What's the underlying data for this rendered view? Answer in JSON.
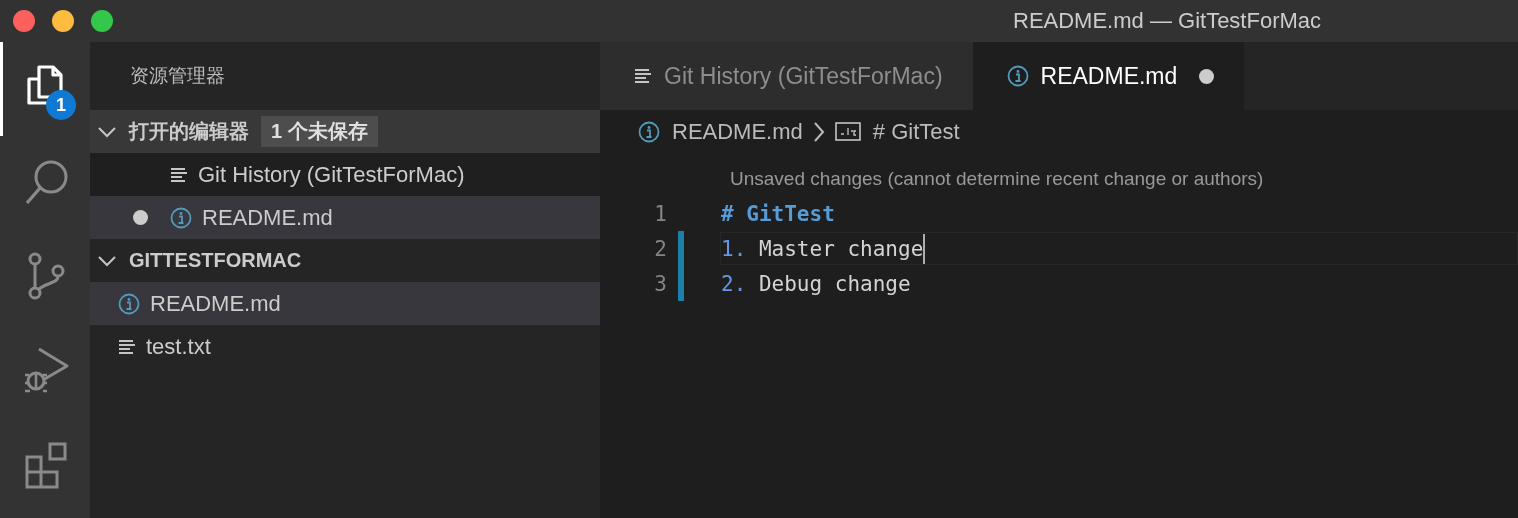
{
  "window": {
    "title": "README.md — GitTestForMac"
  },
  "activity_bar": [
    {
      "kind": "explorer",
      "selected": true,
      "badge": "1"
    },
    {
      "kind": "search",
      "selected": false
    },
    {
      "kind": "source-control",
      "selected": false
    },
    {
      "kind": "debug",
      "selected": false
    },
    {
      "kind": "extensions",
      "selected": false
    }
  ],
  "sidebar": {
    "title": "资源管理器",
    "sections": [
      {
        "label": "打开的编辑器",
        "kind": "plain",
        "badge": "1 个未保存",
        "expanded": true,
        "items": [
          {
            "label": "Git History (GitTestForMac)",
            "kind": "text",
            "dirty": false,
            "focused": true,
            "selected": false
          },
          {
            "label": "README.md",
            "kind": "info",
            "dirty": true,
            "focused": false,
            "selected": true
          }
        ]
      },
      {
        "label": "GITTESTFORMAC",
        "kind": "folder",
        "expanded": true,
        "items": [
          {
            "label": "README.md",
            "kind": "info",
            "dirty": false,
            "focused": false,
            "selected": true
          },
          {
            "label": "test.txt",
            "kind": "text",
            "dirty": false,
            "focused": false,
            "selected": false
          }
        ]
      }
    ]
  },
  "tabs": [
    {
      "label": "Git History (GitTestForMac)",
      "kind": "text",
      "selected": false,
      "dirty": false
    },
    {
      "label": "README.md",
      "kind": "info",
      "selected": true,
      "dirty": true
    }
  ],
  "breadcrumbs": [
    {
      "label": "README.md",
      "kind": "info"
    },
    {
      "label": "# GitTest",
      "kind": "symbol"
    }
  ],
  "codelens": "Unsaved changes (cannot determine recent change or authors)",
  "lines": [
    {
      "number": "1",
      "changed": false,
      "current": false,
      "tokens": [
        {
          "text": "# GitTest",
          "kind": "heading"
        }
      ]
    },
    {
      "number": "2",
      "changed": true,
      "current": true,
      "tokens": [
        {
          "text": "1.",
          "kind": "list-marker"
        },
        {
          "text": " Master change",
          "kind": "text"
        }
      ]
    },
    {
      "number": "3",
      "changed": true,
      "current": false,
      "tokens": [
        {
          "text": "2.",
          "kind": "list-marker"
        },
        {
          "text": " Debug change",
          "kind": "text"
        }
      ]
    }
  ]
}
